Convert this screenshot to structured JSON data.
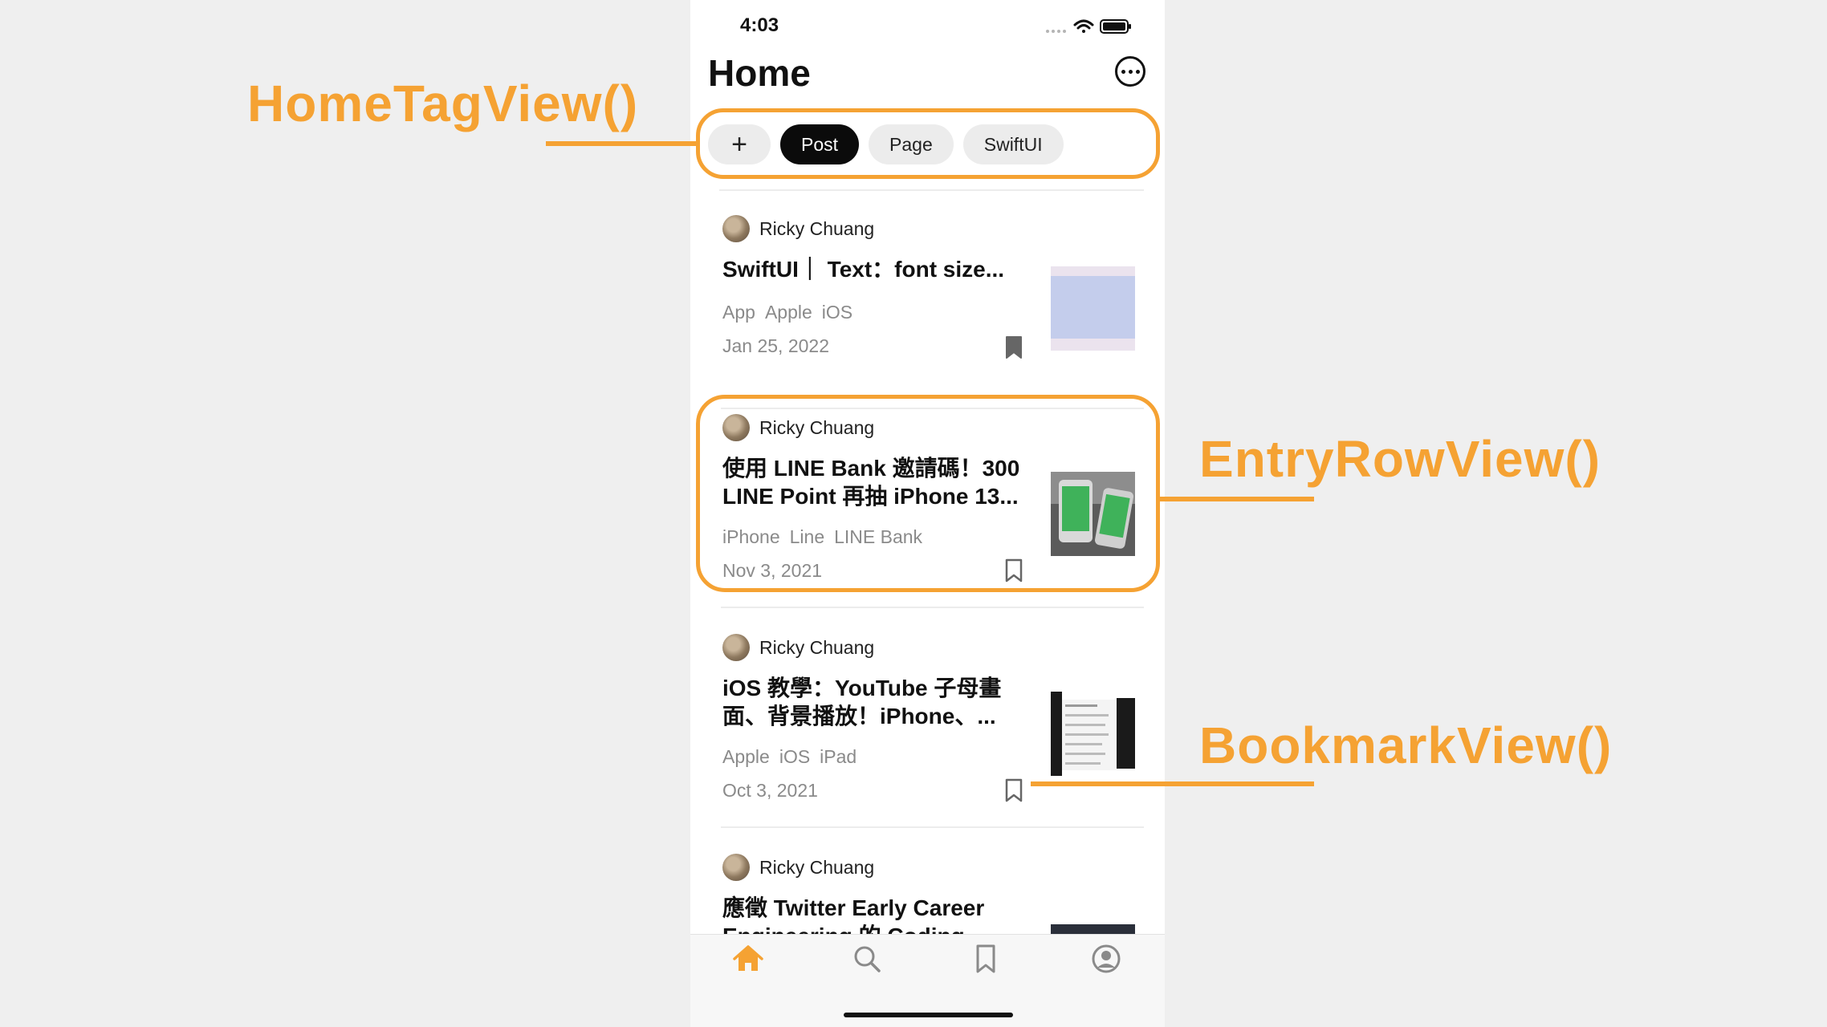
{
  "status_bar": {
    "time": "4:03"
  },
  "nav": {
    "title": "Home"
  },
  "tags": [
    {
      "label": "+",
      "selected": false
    },
    {
      "label": "Post",
      "selected": true
    },
    {
      "label": "Page",
      "selected": false
    },
    {
      "label": "SwiftUI",
      "selected": false
    }
  ],
  "entries": [
    {
      "author": "Ricky Chuang",
      "title": "SwiftUI｜ Text：font size...",
      "tags": [
        "App",
        "Apple",
        "iOS"
      ],
      "date": "Jan 25, 2022",
      "bookmarked": true
    },
    {
      "author": "Ricky Chuang",
      "title": "使用 LINE Bank 邀請碼！300 LINE Point 再抽 iPhone 13...",
      "tags": [
        "iPhone",
        "Line",
        "LINE Bank"
      ],
      "date": "Nov 3, 2021",
      "bookmarked": false
    },
    {
      "author": "Ricky Chuang",
      "title": "iOS 教學：YouTube 子母畫面、背景播放！iPhone、...",
      "tags": [
        "Apple",
        "iOS",
        "iPad"
      ],
      "date": "Oct 3, 2021",
      "bookmarked": false
    },
    {
      "author": "Ricky Chuang",
      "title": "應徵 Twitter Early Career Engineering 的 Coding",
      "tags": [],
      "date": "",
      "bookmarked": false
    }
  ],
  "tab_bar": {
    "items": [
      "home-icon",
      "search-icon",
      "bookmark-icon",
      "profile-icon"
    ],
    "active_index": 0
  },
  "annotations": {
    "home_tag_view": "HomeTagView()",
    "entry_row_view": "EntryRowView()",
    "bookmark_view": "BookmarkView()"
  },
  "colors": {
    "accent": "#f5a233",
    "tag_active_bg": "#0b0b0b",
    "tab_active": "#f5a233",
    "tab_inactive": "#8a8a8a"
  }
}
